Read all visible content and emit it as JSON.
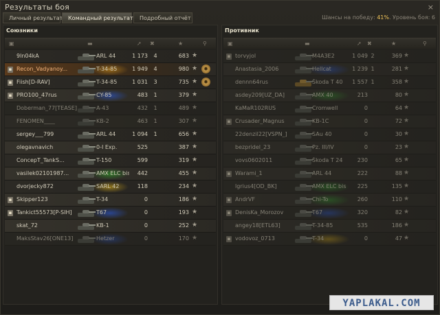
{
  "window": {
    "title": "Результаты боя",
    "close": "×"
  },
  "tabs": [
    {
      "label": "Личный результат",
      "active": false
    },
    {
      "label": "Командный результат",
      "active": true
    },
    {
      "label": "Подробный отчёт",
      "active": false
    }
  ],
  "status": {
    "prefix": "Шансы на победу:",
    "chance": "41%",
    "suffix": ". Уровень боя: 6"
  },
  "columns": {
    "damage_icon": "shell-icon",
    "frags_icon": "destroyed-tank-icon",
    "xp_icon": "star-icon",
    "medal_icon": "medal-icon"
  },
  "allies": {
    "title": "Союзники",
    "players": [
      {
        "name": "9ln04kA",
        "tank": "ARL 44",
        "damage": "1 173",
        "kills": "4",
        "xp": "683",
        "color": "",
        "dead": false,
        "self": false,
        "badge": false,
        "medal": false
      },
      {
        "name": "Recon_Vadyanoy...",
        "tank": "T-34-85",
        "damage": "1 949",
        "kills": "4",
        "xp": "980",
        "color": "#c98a18",
        "dead": false,
        "self": true,
        "badge": true,
        "medal": true
      },
      {
        "name": "Fiish[D-RAV]",
        "tank": "T-34-85",
        "damage": "1 031",
        "kills": "3",
        "xp": "735",
        "color": "",
        "dead": false,
        "self": false,
        "badge": true,
        "medal": true
      },
      {
        "name": "PRO100_47rus",
        "tank": "CY-85",
        "damage": "483",
        "kills": "1",
        "xp": "379",
        "color": "#2b55c8",
        "dead": false,
        "self": false,
        "badge": true,
        "medal": false
      },
      {
        "name": "Doberman_77[TEASE]",
        "tank": "A-43",
        "damage": "432",
        "kills": "1",
        "xp": "489",
        "color": "",
        "dead": true,
        "self": false,
        "badge": false,
        "medal": false
      },
      {
        "name": "FENOMEN____",
        "tank": "KB-2",
        "damage": "463",
        "kills": "1",
        "xp": "307",
        "color": "",
        "dead": true,
        "self": false,
        "badge": false,
        "medal": false
      },
      {
        "name": "sergey___799",
        "tank": "ARL 44",
        "damage": "1 094",
        "kills": "1",
        "xp": "656",
        "color": "",
        "dead": false,
        "self": false,
        "badge": false,
        "medal": false
      },
      {
        "name": "olegavnavich",
        "tank": "0-I Exp.",
        "damage": "525",
        "kills": "",
        "xp": "387",
        "color": "",
        "dead": false,
        "self": false,
        "badge": false,
        "medal": false
      },
      {
        "name": "ConcepT_TankS...",
        "tank": "T-150",
        "damage": "599",
        "kills": "",
        "xp": "319",
        "color": "",
        "dead": false,
        "self": false,
        "badge": false,
        "medal": false
      },
      {
        "name": "vasilek02101987...",
        "tank": "AMX ELC bis",
        "damage": "442",
        "kills": "",
        "xp": "455",
        "color": "#2f9a2a",
        "dead": false,
        "self": false,
        "badge": false,
        "medal": false
      },
      {
        "name": "dvorjecky872",
        "tank": "SARL 42",
        "damage": "118",
        "kills": "",
        "xp": "234",
        "color": "#c9a018",
        "dead": false,
        "self": false,
        "badge": false,
        "medal": false
      },
      {
        "name": "Skipper123",
        "tank": "T-34",
        "damage": "0",
        "kills": "",
        "xp": "186",
        "color": "",
        "dead": false,
        "self": false,
        "badge": true,
        "medal": false
      },
      {
        "name": "Tankict55573[P-SIH]",
        "tank": "T67",
        "damage": "0",
        "kills": "",
        "xp": "193",
        "color": "#2b55c8",
        "dead": false,
        "self": false,
        "badge": true,
        "medal": false
      },
      {
        "name": "skat_72",
        "tank": "KB-1",
        "damage": "0",
        "kills": "",
        "xp": "252",
        "color": "",
        "dead": false,
        "self": false,
        "badge": false,
        "medal": false
      },
      {
        "name": "MaksStav26[ONE13]",
        "tank": "Hetzer",
        "damage": "0",
        "kills": "",
        "xp": "170",
        "color": "#2b55c8",
        "dead": true,
        "self": false,
        "badge": false,
        "medal": false
      }
    ]
  },
  "enemies": {
    "title": "Противник",
    "players": [
      {
        "name": "torvyjol",
        "tank": "M4A3E2",
        "damage": "1 049",
        "kills": "2",
        "xp": "369",
        "color": "",
        "dead": true,
        "badge": true
      },
      {
        "name": "Anastasia_2006",
        "tank": "Hellcat",
        "damage": "1 239",
        "kills": "1",
        "xp": "281",
        "color": "#2b55c8",
        "dead": true,
        "badge": false
      },
      {
        "name": "dennn64rus",
        "tank": "Škoda T 40",
        "damage": "1 557",
        "kills": "1",
        "xp": "358",
        "color": "",
        "dead": true,
        "badge": false,
        "gold": true
      },
      {
        "name": "asdey209[UZ_DA]",
        "tank": "AMX 40",
        "damage": "213",
        "kills": "",
        "xp": "80",
        "color": "#2f9a2a",
        "dead": true,
        "badge": false
      },
      {
        "name": "KaMaR102RUS",
        "tank": "Cromwell",
        "damage": "0",
        "kills": "",
        "xp": "64",
        "color": "",
        "dead": true,
        "badge": false
      },
      {
        "name": "Crusader_Magnus",
        "tank": "KB-1C",
        "damage": "0",
        "kills": "",
        "xp": "72",
        "color": "",
        "dead": true,
        "badge": true
      },
      {
        "name": "22denzil22[VSPN_]",
        "tank": "SAu 40",
        "damage": "0",
        "kills": "",
        "xp": "30",
        "color": "",
        "dead": true,
        "badge": false
      },
      {
        "name": "bezpridel_23",
        "tank": "Pz. III/IV",
        "damage": "0",
        "kills": "",
        "xp": "23",
        "color": "",
        "dead": true,
        "badge": false
      },
      {
        "name": "vovs0602011",
        "tank": "Škoda T 24",
        "damage": "230",
        "kills": "",
        "xp": "65",
        "color": "",
        "dead": true,
        "badge": false
      },
      {
        "name": "Warami_1",
        "tank": "ARL 44",
        "damage": "222",
        "kills": "",
        "xp": "88",
        "color": "",
        "dead": true,
        "badge": true
      },
      {
        "name": "lgrius4[OD_BK]",
        "tank": "AMX ELC bis",
        "damage": "225",
        "kills": "",
        "xp": "135",
        "color": "#2f9a2a",
        "dead": true,
        "badge": false
      },
      {
        "name": "AndrVF",
        "tank": "Chi-To",
        "damage": "260",
        "kills": "",
        "xp": "110",
        "color": "#2f9a2a",
        "dead": true,
        "badge": true
      },
      {
        "name": "DenisKa_Morozov",
        "tank": "T67",
        "damage": "320",
        "kills": "",
        "xp": "82",
        "color": "#2b55c8",
        "dead": true,
        "badge": true
      },
      {
        "name": "angey18[ETL63]",
        "tank": "T-34-85",
        "damage": "535",
        "kills": "",
        "xp": "186",
        "color": "",
        "dead": true,
        "badge": false
      },
      {
        "name": "vodovoz_0713",
        "tank": "T-34",
        "damage": "0",
        "kills": "",
        "xp": "47",
        "color": "#c9a018",
        "dead": true,
        "badge": true
      }
    ]
  },
  "watermark": "YAPLAKAL.COM"
}
